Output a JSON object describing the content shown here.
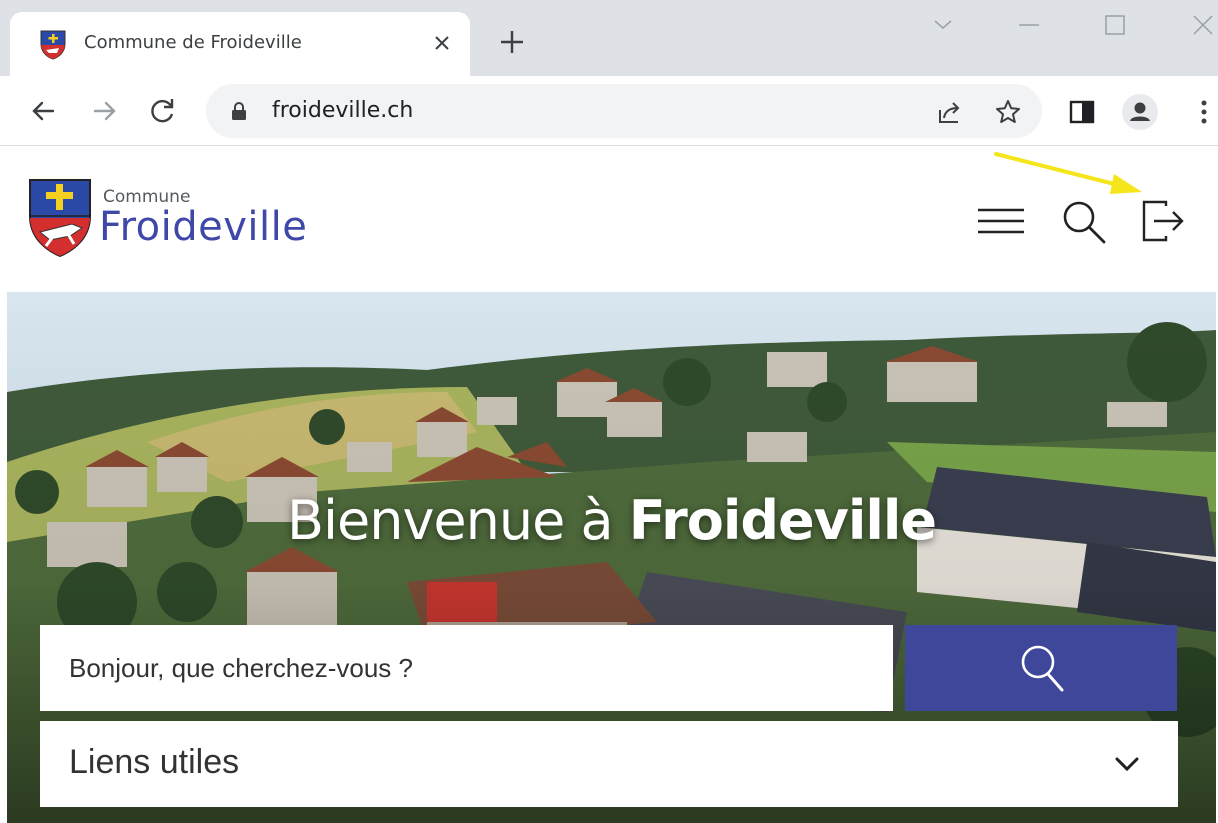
{
  "browser": {
    "tab_title": "Commune de Froideville",
    "url": "froideville.ch",
    "icons": [
      "back-arrow-icon",
      "forward-arrow-icon",
      "reload-icon",
      "lock-icon",
      "share-icon",
      "star-icon",
      "side-panel-icon",
      "profile-icon",
      "menu-dots-icon",
      "close-icon",
      "plus-icon",
      "minimize-icon",
      "maximize-icon",
      "chevron-down-icon"
    ]
  },
  "site": {
    "logo_small": "Commune",
    "logo_big": "Froideville",
    "header_icons": [
      "hamburger-menu-icon",
      "search-icon",
      "logout-icon"
    ]
  },
  "hero": {
    "title_regular": "Bienvenue à ",
    "title_bold": "Froideville",
    "search_placeholder": "Bonjour, que cherchez-vous ?",
    "links_label": "Liens utiles"
  },
  "colors": {
    "brand_blue": "#3f479b",
    "annotation_arrow": "#f5e51b"
  }
}
